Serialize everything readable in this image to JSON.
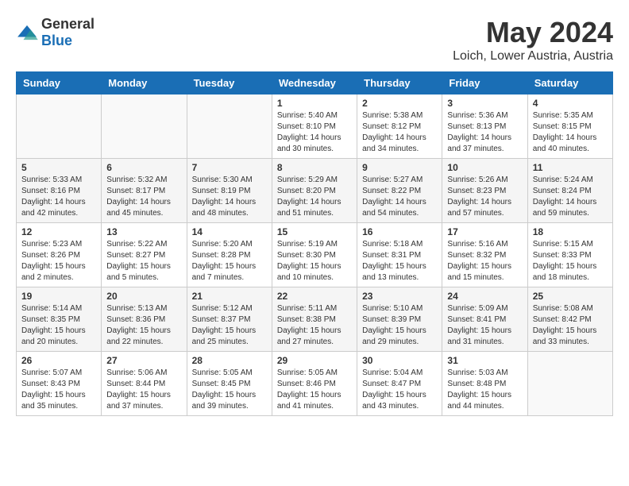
{
  "logo": {
    "general": "General",
    "blue": "Blue"
  },
  "title": "May 2024",
  "location": "Loich, Lower Austria, Austria",
  "days_of_week": [
    "Sunday",
    "Monday",
    "Tuesday",
    "Wednesday",
    "Thursday",
    "Friday",
    "Saturday"
  ],
  "weeks": [
    [
      {
        "day": "",
        "content": ""
      },
      {
        "day": "",
        "content": ""
      },
      {
        "day": "",
        "content": ""
      },
      {
        "day": "1",
        "content": "Sunrise: 5:40 AM\nSunset: 8:10 PM\nDaylight: 14 hours\nand 30 minutes."
      },
      {
        "day": "2",
        "content": "Sunrise: 5:38 AM\nSunset: 8:12 PM\nDaylight: 14 hours\nand 34 minutes."
      },
      {
        "day": "3",
        "content": "Sunrise: 5:36 AM\nSunset: 8:13 PM\nDaylight: 14 hours\nand 37 minutes."
      },
      {
        "day": "4",
        "content": "Sunrise: 5:35 AM\nSunset: 8:15 PM\nDaylight: 14 hours\nand 40 minutes."
      }
    ],
    [
      {
        "day": "5",
        "content": "Sunrise: 5:33 AM\nSunset: 8:16 PM\nDaylight: 14 hours\nand 42 minutes."
      },
      {
        "day": "6",
        "content": "Sunrise: 5:32 AM\nSunset: 8:17 PM\nDaylight: 14 hours\nand 45 minutes."
      },
      {
        "day": "7",
        "content": "Sunrise: 5:30 AM\nSunset: 8:19 PM\nDaylight: 14 hours\nand 48 minutes."
      },
      {
        "day": "8",
        "content": "Sunrise: 5:29 AM\nSunset: 8:20 PM\nDaylight: 14 hours\nand 51 minutes."
      },
      {
        "day": "9",
        "content": "Sunrise: 5:27 AM\nSunset: 8:22 PM\nDaylight: 14 hours\nand 54 minutes."
      },
      {
        "day": "10",
        "content": "Sunrise: 5:26 AM\nSunset: 8:23 PM\nDaylight: 14 hours\nand 57 minutes."
      },
      {
        "day": "11",
        "content": "Sunrise: 5:24 AM\nSunset: 8:24 PM\nDaylight: 14 hours\nand 59 minutes."
      }
    ],
    [
      {
        "day": "12",
        "content": "Sunrise: 5:23 AM\nSunset: 8:26 PM\nDaylight: 15 hours\nand 2 minutes."
      },
      {
        "day": "13",
        "content": "Sunrise: 5:22 AM\nSunset: 8:27 PM\nDaylight: 15 hours\nand 5 minutes."
      },
      {
        "day": "14",
        "content": "Sunrise: 5:20 AM\nSunset: 8:28 PM\nDaylight: 15 hours\nand 7 minutes."
      },
      {
        "day": "15",
        "content": "Sunrise: 5:19 AM\nSunset: 8:30 PM\nDaylight: 15 hours\nand 10 minutes."
      },
      {
        "day": "16",
        "content": "Sunrise: 5:18 AM\nSunset: 8:31 PM\nDaylight: 15 hours\nand 13 minutes."
      },
      {
        "day": "17",
        "content": "Sunrise: 5:16 AM\nSunset: 8:32 PM\nDaylight: 15 hours\nand 15 minutes."
      },
      {
        "day": "18",
        "content": "Sunrise: 5:15 AM\nSunset: 8:33 PM\nDaylight: 15 hours\nand 18 minutes."
      }
    ],
    [
      {
        "day": "19",
        "content": "Sunrise: 5:14 AM\nSunset: 8:35 PM\nDaylight: 15 hours\nand 20 minutes."
      },
      {
        "day": "20",
        "content": "Sunrise: 5:13 AM\nSunset: 8:36 PM\nDaylight: 15 hours\nand 22 minutes."
      },
      {
        "day": "21",
        "content": "Sunrise: 5:12 AM\nSunset: 8:37 PM\nDaylight: 15 hours\nand 25 minutes."
      },
      {
        "day": "22",
        "content": "Sunrise: 5:11 AM\nSunset: 8:38 PM\nDaylight: 15 hours\nand 27 minutes."
      },
      {
        "day": "23",
        "content": "Sunrise: 5:10 AM\nSunset: 8:39 PM\nDaylight: 15 hours\nand 29 minutes."
      },
      {
        "day": "24",
        "content": "Sunrise: 5:09 AM\nSunset: 8:41 PM\nDaylight: 15 hours\nand 31 minutes."
      },
      {
        "day": "25",
        "content": "Sunrise: 5:08 AM\nSunset: 8:42 PM\nDaylight: 15 hours\nand 33 minutes."
      }
    ],
    [
      {
        "day": "26",
        "content": "Sunrise: 5:07 AM\nSunset: 8:43 PM\nDaylight: 15 hours\nand 35 minutes."
      },
      {
        "day": "27",
        "content": "Sunrise: 5:06 AM\nSunset: 8:44 PM\nDaylight: 15 hours\nand 37 minutes."
      },
      {
        "day": "28",
        "content": "Sunrise: 5:05 AM\nSunset: 8:45 PM\nDaylight: 15 hours\nand 39 minutes."
      },
      {
        "day": "29",
        "content": "Sunrise: 5:05 AM\nSunset: 8:46 PM\nDaylight: 15 hours\nand 41 minutes."
      },
      {
        "day": "30",
        "content": "Sunrise: 5:04 AM\nSunset: 8:47 PM\nDaylight: 15 hours\nand 43 minutes."
      },
      {
        "day": "31",
        "content": "Sunrise: 5:03 AM\nSunset: 8:48 PM\nDaylight: 15 hours\nand 44 minutes."
      },
      {
        "day": "",
        "content": ""
      }
    ]
  ]
}
